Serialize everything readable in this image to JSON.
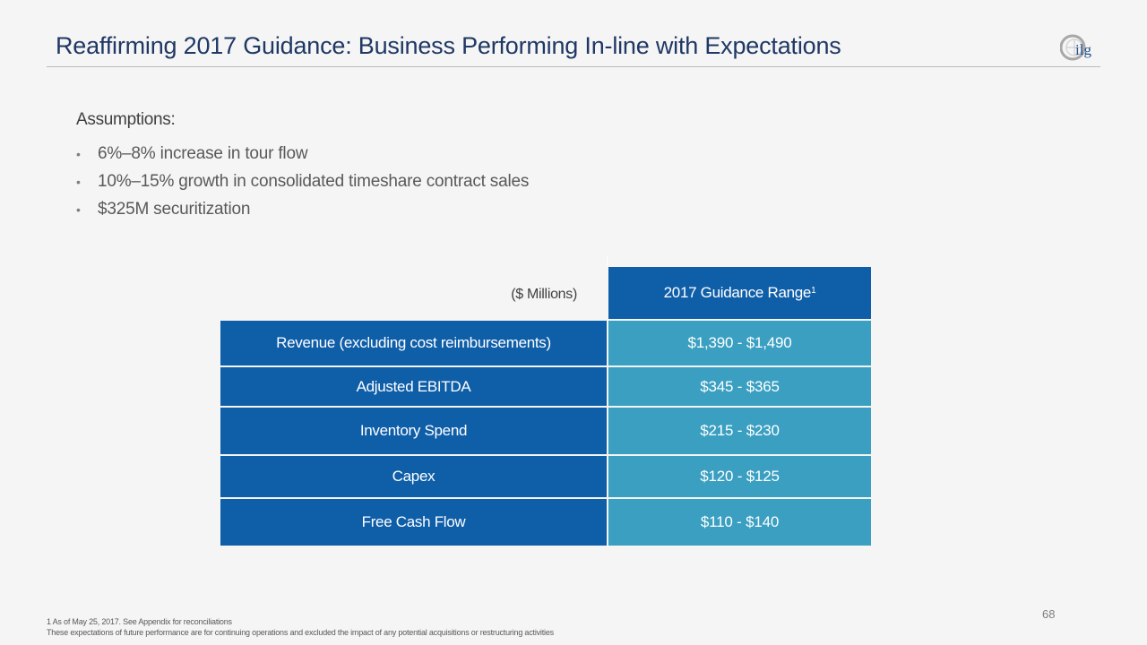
{
  "slide": {
    "title": "Reaffirming 2017 Guidance: Business Performing In-line with Expectations",
    "logo_text": "ilg",
    "page_number": "68"
  },
  "assumptions": {
    "heading": "Assumptions:",
    "items": [
      "6%–8% increase in tour flow",
      "10%–15% growth in consolidated timeshare contract sales",
      "$325M securitization"
    ]
  },
  "guidance_table": {
    "units_label": "($ Millions)",
    "column_header": "2017 Guidance Range",
    "column_header_footnote": "1",
    "rows": [
      {
        "label": "Revenue (excluding cost reimbursements)",
        "value": "$1,390 - $1,490"
      },
      {
        "label": "Adjusted EBITDA",
        "value": "$345 - $365"
      },
      {
        "label": "Inventory Spend",
        "value": "$215 - $230"
      },
      {
        "label": "Capex",
        "value": "$120 - $125"
      },
      {
        "label": "Free Cash Flow",
        "value": "$110 - $140"
      }
    ]
  },
  "footnotes": {
    "line1": "1 As of May 25, 2017. See Appendix for reconciliations",
    "line2": "These expectations of future performance are for continuing operations and excluded the impact of any potential acquisitions or restructuring activities"
  },
  "colors": {
    "title": "#1f3864",
    "table_dark_blue": "#0f5ea8",
    "table_light_blue": "#3a9fc1",
    "background": "#f5f5f5"
  }
}
